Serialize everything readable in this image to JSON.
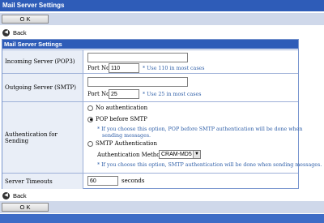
{
  "page": {
    "title": "Mail Server Settings"
  },
  "toolbar": {
    "ok_label": "O K",
    "back_label": "Back"
  },
  "panel": {
    "title": "Mail Server Settings"
  },
  "incoming": {
    "label": "Incoming Server (POP3)",
    "server_value": "",
    "port_label": "Port No.",
    "port_value": "110",
    "note": "* Use 110 in most cases"
  },
  "outgoing": {
    "label": "Outgoing Server (SMTP)",
    "server_value": "",
    "port_label": "Port No.",
    "port_value": "25",
    "note": "* Use 25 in most cases"
  },
  "auth": {
    "label": "Authentication for Sending",
    "options": [
      {
        "label": "No authentication",
        "checked": false
      },
      {
        "label": "POP before SMTP",
        "checked": true
      },
      {
        "label": "SMTP Authentication",
        "checked": false
      }
    ],
    "pop_note_1": "* If you choose this option, POP before SMTP authentication will be done when",
    "pop_note_2": "sending messages.",
    "method_label": "Authentication Method",
    "method_value": "CRAM-MD5",
    "smtp_note": "* If you choose this option, SMTP authentication will be done when sending messages."
  },
  "timeouts": {
    "label": "Server Timeouts",
    "value": "60",
    "unit": "seconds"
  },
  "colors": {
    "header_blue": "#2e5cb8",
    "note_blue": "#2f5fa8",
    "label_bg": "#e9eef7"
  }
}
